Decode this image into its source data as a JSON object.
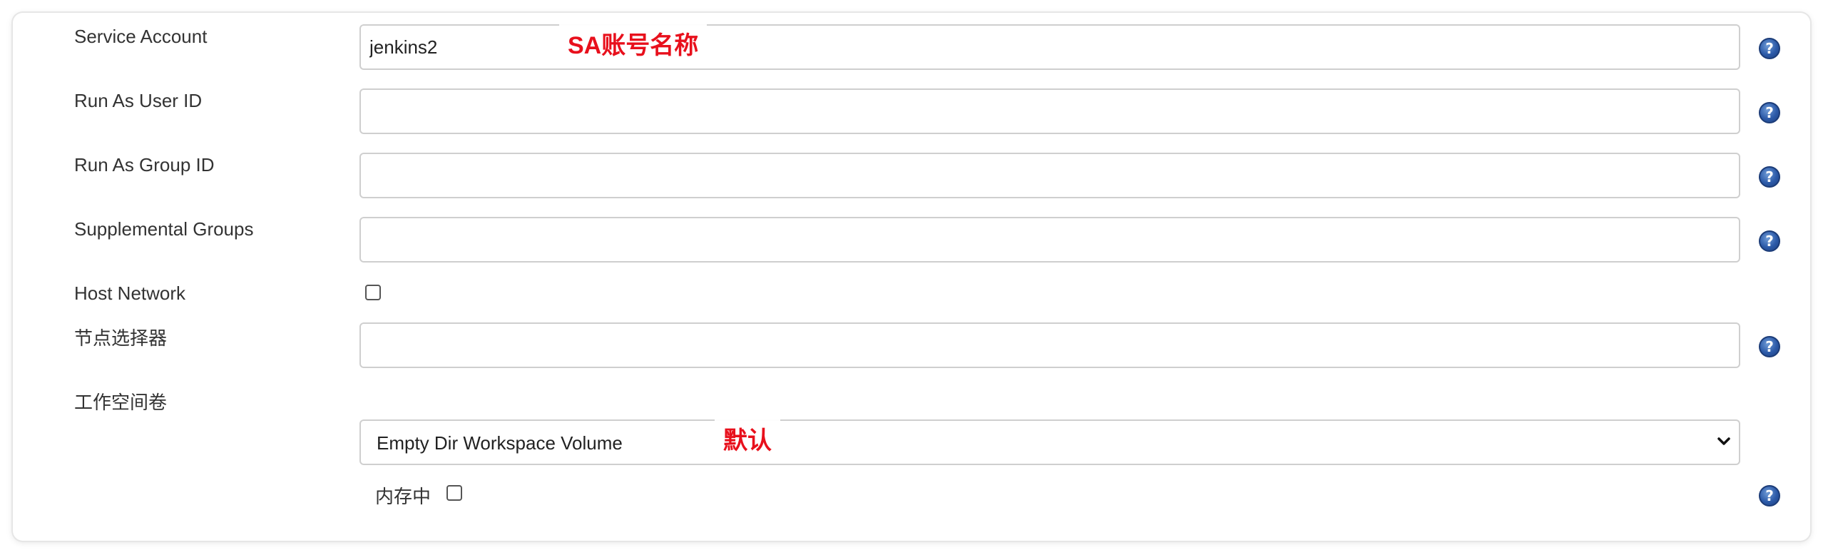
{
  "fields": {
    "service_account": {
      "label": "Service Account",
      "value": "jenkins2",
      "annotation": "SA账号名称"
    },
    "run_as_user_id": {
      "label": "Run As User ID",
      "value": ""
    },
    "run_as_group_id": {
      "label": "Run As Group ID",
      "value": ""
    },
    "supplemental_groups": {
      "label": "Supplemental Groups",
      "value": ""
    },
    "host_network": {
      "label": "Host Network",
      "checked": false
    },
    "node_selector": {
      "label": "节点选择器",
      "value": ""
    },
    "workspace_volume": {
      "label": "工作空间卷",
      "selected": "Empty Dir Workspace Volume",
      "annotation": "默认",
      "in_memory_label": "内存中",
      "in_memory_checked": false
    }
  },
  "icons": {
    "help": "help-icon",
    "dropdown": "chevron-down-icon"
  },
  "colors": {
    "annotation": "#e8101c",
    "help_icon": "#2c5aa8"
  }
}
